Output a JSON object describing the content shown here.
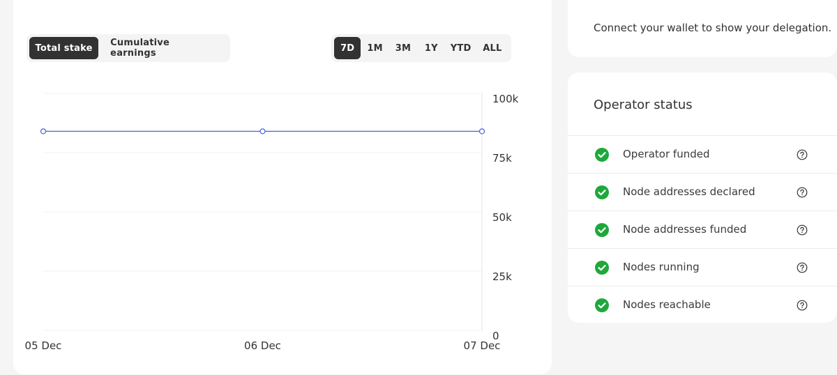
{
  "chart_panel": {
    "series_tabs": [
      {
        "label": "Total stake",
        "active": true
      },
      {
        "label": "Cumulative earnings",
        "active": false
      }
    ],
    "range_tabs": [
      {
        "label": "7D",
        "active": true
      },
      {
        "label": "1M",
        "active": false
      },
      {
        "label": "3M",
        "active": false
      },
      {
        "label": "1Y",
        "active": false
      },
      {
        "label": "YTD",
        "active": false
      },
      {
        "label": "ALL",
        "active": false
      }
    ]
  },
  "chart_data": {
    "type": "line",
    "x": [
      "05 Dec",
      "06 Dec",
      "07 Dec"
    ],
    "series": [
      {
        "values": [
          84000,
          84000,
          84000
        ]
      }
    ],
    "y_ticks": [
      "100k",
      "75k",
      "50k",
      "25k",
      "0"
    ],
    "ylim": [
      0,
      100000
    ],
    "grid": true,
    "y_axis_side": "right",
    "line_color": "#4a5de6"
  },
  "wallet_panel": {
    "message": "Connect your wallet to show your delegation."
  },
  "status_panel": {
    "title": "Operator status",
    "items": [
      {
        "label": "Operator funded",
        "ok": true
      },
      {
        "label": "Node addresses declared",
        "ok": true
      },
      {
        "label": "Node addresses funded",
        "ok": true
      },
      {
        "label": "Nodes running",
        "ok": true
      },
      {
        "label": "Nodes reachable",
        "ok": true
      }
    ]
  },
  "colors": {
    "active_tab_bg": "#323232",
    "check_green": "#1ea83a",
    "background": "#f5f5f5"
  }
}
